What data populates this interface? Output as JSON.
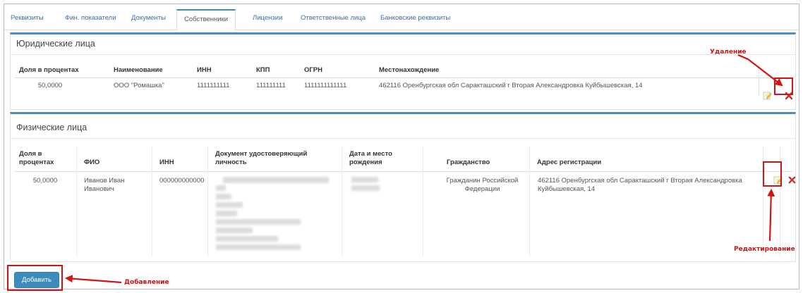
{
  "tabs": [
    "Реквизиты",
    "Фин. показатели",
    "Документы",
    "Собственники",
    "Лицензии",
    "Ответственные лица",
    "Банковские реквизиты"
  ],
  "legal": {
    "title": "Юридические лица",
    "headers": [
      "Доля в процентах",
      "Наименование",
      "ИНН",
      "КПП",
      "ОГРН",
      "Местонахождение"
    ],
    "row": {
      "share": "50,0000",
      "name": "ООО \"Ромашка\"",
      "inn": "1111111111",
      "kpp": "111111111",
      "ogrn": "1111111111111",
      "address": "462116 Оренбургская обл Саракташский г Вторая Александровка Куйбышевская, 14"
    }
  },
  "physical": {
    "title": "Физические лица",
    "headers": {
      "share": "Доля в процентах",
      "fio": "ФИО",
      "inn": "ИНН",
      "document": "Документ удостоверяющий личность",
      "birth": "Дата и место рождения",
      "citizenship": "Гражданство",
      "address": "Адрес регистрации"
    },
    "row": {
      "share": "50,0000",
      "fio": "Иванов Иван Иванович",
      "inn": "000000000000",
      "citizenship": "Гражданин Российской Федерации",
      "address": "462116 Оренбургская обл Саракташский г Вторая Александровка Куйбышевская, 14"
    }
  },
  "add_button": "Добавить",
  "annotations": {
    "delete": "Удаление",
    "edit": "Редактирование",
    "add": "Добавление"
  },
  "colors": {
    "accent": "#3c8dbc",
    "annotation": "#d41414",
    "delete_icon": "#c9302c",
    "tab_link": "#3e6da4"
  },
  "icons": {
    "edit": "pencil-note-icon",
    "delete": "red-x-icon"
  }
}
